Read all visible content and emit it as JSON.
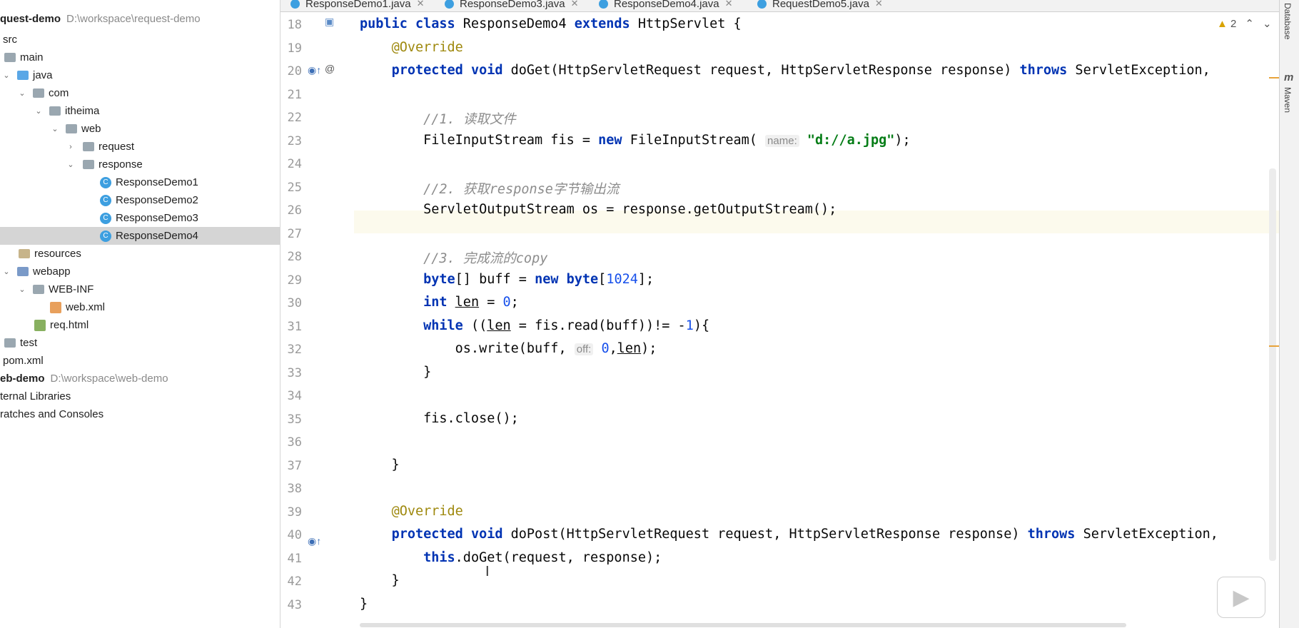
{
  "project": {
    "items": [
      {
        "label": "quest-demo",
        "note": "D:\\workspace\\request-demo",
        "bold": true
      },
      {
        "label": "src"
      },
      {
        "label": "main"
      },
      {
        "label": "java"
      },
      {
        "label": "com"
      },
      {
        "label": "itheima"
      },
      {
        "label": "web"
      },
      {
        "label": "request"
      },
      {
        "label": "response"
      },
      {
        "label": "ResponseDemo1"
      },
      {
        "label": "ResponseDemo2"
      },
      {
        "label": "ResponseDemo3"
      },
      {
        "label": "ResponseDemo4"
      },
      {
        "label": "resources"
      },
      {
        "label": "webapp"
      },
      {
        "label": "WEB-INF"
      },
      {
        "label": "web.xml"
      },
      {
        "label": "req.html"
      },
      {
        "label": "test"
      },
      {
        "label": "pom.xml"
      },
      {
        "label": "eb-demo",
        "note": "D:\\workspace\\web-demo",
        "bold": true
      },
      {
        "label": "ternal Libraries"
      },
      {
        "label": "ratches and Consoles"
      }
    ]
  },
  "tabs": [
    {
      "label": "ResponseDemo1.java"
    },
    {
      "label": "ResponseDemo3.java"
    },
    {
      "label": "ResponseDemo4.java",
      "active": true
    },
    {
      "label": "RequestDemo5.java"
    }
  ],
  "editor": {
    "line_numbers": [
      "18",
      "19",
      "20",
      "21",
      "22",
      "23",
      "24",
      "25",
      "26",
      "27",
      "28",
      "29",
      "30",
      "31",
      "32",
      "33",
      "34",
      "35",
      "36",
      "37",
      "38",
      "39",
      "40",
      "41",
      "42",
      "43"
    ],
    "warning_count": "2",
    "hints": {
      "name": "name:",
      "off": "off:"
    }
  },
  "right_tools": {
    "database": "Database",
    "maven": "Maven"
  }
}
